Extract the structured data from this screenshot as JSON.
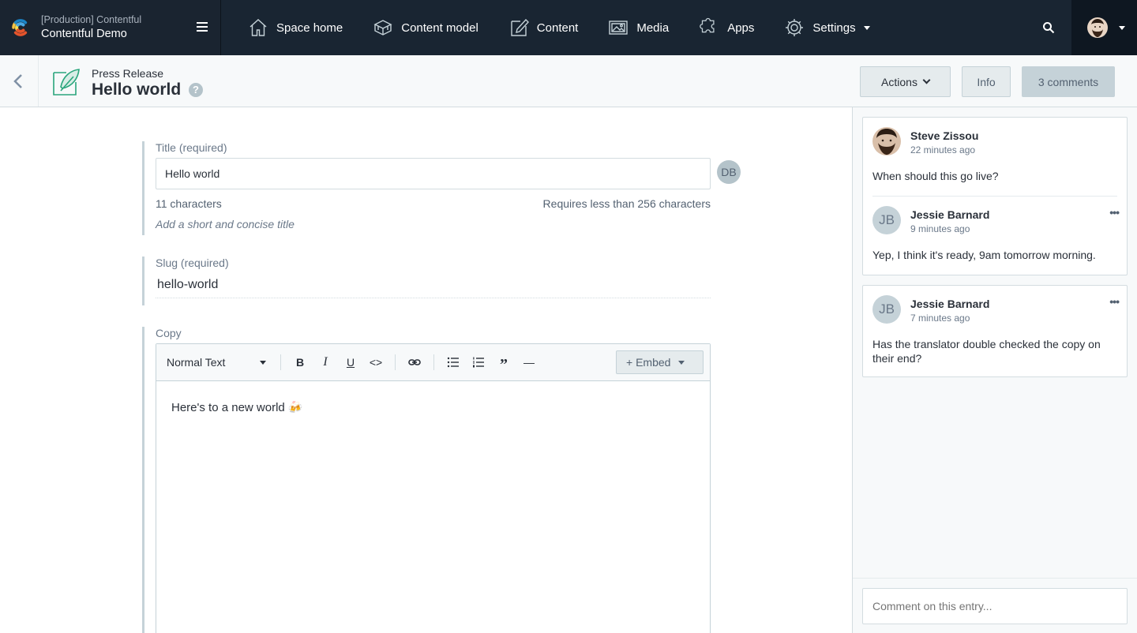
{
  "topnav": {
    "space_env": "[Production] Contentful",
    "space_name": "Contentful Demo",
    "items": [
      {
        "label": "Space home",
        "icon": "house-icon"
      },
      {
        "label": "Content model",
        "icon": "content-model-icon"
      },
      {
        "label": "Content",
        "icon": "content-edit-icon"
      },
      {
        "label": "Media",
        "icon": "media-icon"
      },
      {
        "label": "Apps",
        "icon": "puzzle-icon"
      },
      {
        "label": "Settings",
        "icon": "gear-icon"
      }
    ]
  },
  "entry": {
    "content_type": "Press Release",
    "title": "Hello world",
    "help": "?",
    "actions_label": "Actions",
    "info_label": "Info",
    "comments_label": "3 comments"
  },
  "fields": {
    "title": {
      "label": "Title (required)",
      "value": "Hello world",
      "char_count": "11 characters",
      "limit": "Requires less than 256 characters",
      "help": "Add a short and concise title",
      "presence": "DB"
    },
    "slug": {
      "label": "Slug (required)",
      "value": "hello-world"
    },
    "copy": {
      "label": "Copy",
      "style": "Normal Text",
      "toolbar": {
        "bold": "B",
        "italic": "I",
        "underline": "U",
        "code": "<>",
        "quote": "”",
        "hr": "—"
      },
      "embed": "+ Embed",
      "body": "Here's to a new world 🍻"
    }
  },
  "comments": [
    {
      "author": "Steve Zissou",
      "time": "22 minutes ago",
      "body": "When should this go live?",
      "initials": ""
    },
    {
      "author": "Jessie Barnard",
      "time": "9 minutes ago",
      "body": "Yep, I think it's ready, 9am tomorrow morning.",
      "initials": "JB",
      "menu": "•••"
    },
    {
      "author": "Jessie Barnard",
      "time": "7 minutes ago",
      "body": "Has the translator double checked the copy on their end?",
      "initials": "JB",
      "menu": "•••"
    }
  ],
  "comment_input": {
    "placeholder": "Comment on this entry..."
  },
  "colors": {
    "nav_bg": "#192532",
    "accent_green": "#2aa67c",
    "sidebar_bg": "#f7f9fa"
  }
}
